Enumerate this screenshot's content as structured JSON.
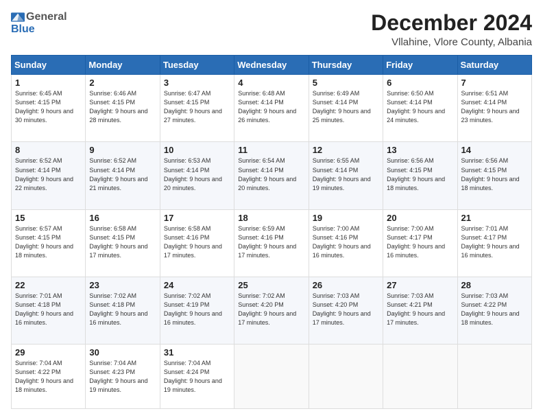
{
  "logo": {
    "general": "General",
    "blue": "Blue"
  },
  "header": {
    "title": "December 2024",
    "subtitle": "Vllahine, Vlore County, Albania"
  },
  "weekdays": [
    "Sunday",
    "Monday",
    "Tuesday",
    "Wednesday",
    "Thursday",
    "Friday",
    "Saturday"
  ],
  "weeks": [
    [
      {
        "day": "1",
        "sunrise": "6:45 AM",
        "sunset": "4:15 PM",
        "daylight": "9 hours and 30 minutes."
      },
      {
        "day": "2",
        "sunrise": "6:46 AM",
        "sunset": "4:15 PM",
        "daylight": "9 hours and 28 minutes."
      },
      {
        "day": "3",
        "sunrise": "6:47 AM",
        "sunset": "4:15 PM",
        "daylight": "9 hours and 27 minutes."
      },
      {
        "day": "4",
        "sunrise": "6:48 AM",
        "sunset": "4:14 PM",
        "daylight": "9 hours and 26 minutes."
      },
      {
        "day": "5",
        "sunrise": "6:49 AM",
        "sunset": "4:14 PM",
        "daylight": "9 hours and 25 minutes."
      },
      {
        "day": "6",
        "sunrise": "6:50 AM",
        "sunset": "4:14 PM",
        "daylight": "9 hours and 24 minutes."
      },
      {
        "day": "7",
        "sunrise": "6:51 AM",
        "sunset": "4:14 PM",
        "daylight": "9 hours and 23 minutes."
      }
    ],
    [
      {
        "day": "8",
        "sunrise": "6:52 AM",
        "sunset": "4:14 PM",
        "daylight": "9 hours and 22 minutes."
      },
      {
        "day": "9",
        "sunrise": "6:52 AM",
        "sunset": "4:14 PM",
        "daylight": "9 hours and 21 minutes."
      },
      {
        "day": "10",
        "sunrise": "6:53 AM",
        "sunset": "4:14 PM",
        "daylight": "9 hours and 20 minutes."
      },
      {
        "day": "11",
        "sunrise": "6:54 AM",
        "sunset": "4:14 PM",
        "daylight": "9 hours and 20 minutes."
      },
      {
        "day": "12",
        "sunrise": "6:55 AM",
        "sunset": "4:14 PM",
        "daylight": "9 hours and 19 minutes."
      },
      {
        "day": "13",
        "sunrise": "6:56 AM",
        "sunset": "4:15 PM",
        "daylight": "9 hours and 18 minutes."
      },
      {
        "day": "14",
        "sunrise": "6:56 AM",
        "sunset": "4:15 PM",
        "daylight": "9 hours and 18 minutes."
      }
    ],
    [
      {
        "day": "15",
        "sunrise": "6:57 AM",
        "sunset": "4:15 PM",
        "daylight": "9 hours and 18 minutes."
      },
      {
        "day": "16",
        "sunrise": "6:58 AM",
        "sunset": "4:15 PM",
        "daylight": "9 hours and 17 minutes."
      },
      {
        "day": "17",
        "sunrise": "6:58 AM",
        "sunset": "4:16 PM",
        "daylight": "9 hours and 17 minutes."
      },
      {
        "day": "18",
        "sunrise": "6:59 AM",
        "sunset": "4:16 PM",
        "daylight": "9 hours and 17 minutes."
      },
      {
        "day": "19",
        "sunrise": "7:00 AM",
        "sunset": "4:16 PM",
        "daylight": "9 hours and 16 minutes."
      },
      {
        "day": "20",
        "sunrise": "7:00 AM",
        "sunset": "4:17 PM",
        "daylight": "9 hours and 16 minutes."
      },
      {
        "day": "21",
        "sunrise": "7:01 AM",
        "sunset": "4:17 PM",
        "daylight": "9 hours and 16 minutes."
      }
    ],
    [
      {
        "day": "22",
        "sunrise": "7:01 AM",
        "sunset": "4:18 PM",
        "daylight": "9 hours and 16 minutes."
      },
      {
        "day": "23",
        "sunrise": "7:02 AM",
        "sunset": "4:18 PM",
        "daylight": "9 hours and 16 minutes."
      },
      {
        "day": "24",
        "sunrise": "7:02 AM",
        "sunset": "4:19 PM",
        "daylight": "9 hours and 16 minutes."
      },
      {
        "day": "25",
        "sunrise": "7:02 AM",
        "sunset": "4:20 PM",
        "daylight": "9 hours and 17 minutes."
      },
      {
        "day": "26",
        "sunrise": "7:03 AM",
        "sunset": "4:20 PM",
        "daylight": "9 hours and 17 minutes."
      },
      {
        "day": "27",
        "sunrise": "7:03 AM",
        "sunset": "4:21 PM",
        "daylight": "9 hours and 17 minutes."
      },
      {
        "day": "28",
        "sunrise": "7:03 AM",
        "sunset": "4:22 PM",
        "daylight": "9 hours and 18 minutes."
      }
    ],
    [
      {
        "day": "29",
        "sunrise": "7:04 AM",
        "sunset": "4:22 PM",
        "daylight": "9 hours and 18 minutes."
      },
      {
        "day": "30",
        "sunrise": "7:04 AM",
        "sunset": "4:23 PM",
        "daylight": "9 hours and 19 minutes."
      },
      {
        "day": "31",
        "sunrise": "7:04 AM",
        "sunset": "4:24 PM",
        "daylight": "9 hours and 19 minutes."
      },
      null,
      null,
      null,
      null
    ]
  ]
}
